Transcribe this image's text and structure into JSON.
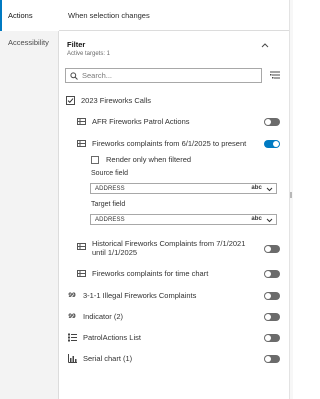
{
  "rail": {
    "tabs": [
      {
        "label": "Actions",
        "active": true
      },
      {
        "label": "Accessibility",
        "active": false
      }
    ]
  },
  "header": {
    "title": "When selection changes"
  },
  "filter": {
    "title": "Filter",
    "subtitle": "Active targets: 1",
    "search_placeholder": "Search...",
    "group_label": "2023 Fireworks Calls",
    "items": [
      {
        "label": "AFR Fireworks Patrol Actions",
        "toggle": false,
        "icon": "layer-icon"
      },
      {
        "label": "Fireworks complaints from 6/1/2025 to present",
        "toggle": true,
        "icon": "layer-icon"
      },
      {
        "label": "Historical Fireworks Complaints from 7/1/2021",
        "label2": "until 1/1/2025",
        "toggle": false,
        "icon": "layer-icon"
      },
      {
        "label": "Fireworks complaints for time chart",
        "toggle": false,
        "icon": "layer-icon"
      },
      {
        "label": "3-1-1 Illegal Fireworks Complaints",
        "toggle": false,
        "icon": "counter-icon"
      },
      {
        "label": "Indicator (2)",
        "toggle": false,
        "icon": "indicator-icon"
      },
      {
        "label": "PatrolActions List",
        "toggle": false,
        "icon": "list-icon"
      },
      {
        "label": "Serial chart (1)",
        "toggle": false,
        "icon": "chart-icon"
      }
    ],
    "render_only_filtered": "Render only when filtered",
    "source_field_label": "Source field",
    "source_field_value": "ADDRESS",
    "target_field_label": "Target field",
    "target_field_value": "ADDRESS",
    "field_type_badge": "abc"
  },
  "colors": {
    "accent": "#007ac2",
    "toggle_off": "#6b6b6b",
    "rail_bg": "#f3f3f3"
  }
}
